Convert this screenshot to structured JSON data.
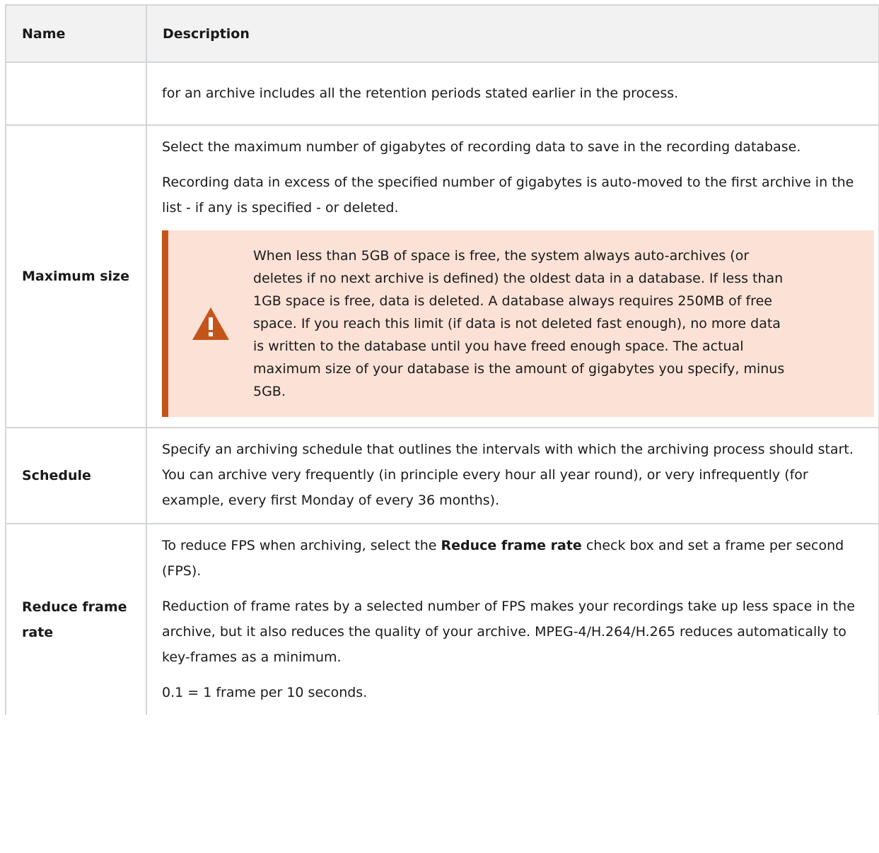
{
  "header": {
    "name": "Name",
    "description": "Description"
  },
  "rows": [
    {
      "name": "",
      "paragraphs": [
        "for an archive includes all the retention periods stated earlier in the process."
      ]
    },
    {
      "name": "Maximum size",
      "paragraphs": [
        "Select the maximum number of gigabytes of recording data to save in the recording database.",
        "Recording data in excess of the specified number of gigabytes is auto-moved to the first archive in the list - if any is specified - or deleted."
      ],
      "warning": {
        "icon": "warning-triangle-icon",
        "text": "When less than 5GB of space is free, the system always auto-archives (or deletes if no next archive is defined) the oldest data in a database. If less than 1GB space is free, data is deleted. A database always requires 250MB of free space. If you reach this limit (if data is not deleted fast enough), no more data is written to the database until you have freed enough space. The actual maximum size of your database is the amount of gigabytes you specify, minus 5GB."
      }
    },
    {
      "name": "Schedule",
      "paragraphs": [
        "Specify an archiving schedule that outlines the intervals with which the archiving process should start. You can archive very frequently (in principle every hour all year round), or very infrequently (for example, every first Monday of every 36 months)."
      ]
    },
    {
      "name": "Reduce frame rate",
      "p1_before": "To reduce FPS when archiving, select the ",
      "p1_bold": "Reduce frame rate",
      "p1_after": " check box and set a frame per second (FPS).",
      "paragraphs": [
        "Reduction of frame rates by a selected number of FPS makes your recordings take up less space in the archive, but it also reduces the quality of your archive. MPEG-4/H.264/H.265 reduces automatically to key-frames as a minimum.",
        "0.1 = 1 frame per 10 seconds."
      ]
    }
  ],
  "colors": {
    "warning_accent": "#c5541a",
    "warning_bg": "#fbe1d6",
    "header_bg": "#f2f2f2",
    "border": "#d3d6d8"
  }
}
